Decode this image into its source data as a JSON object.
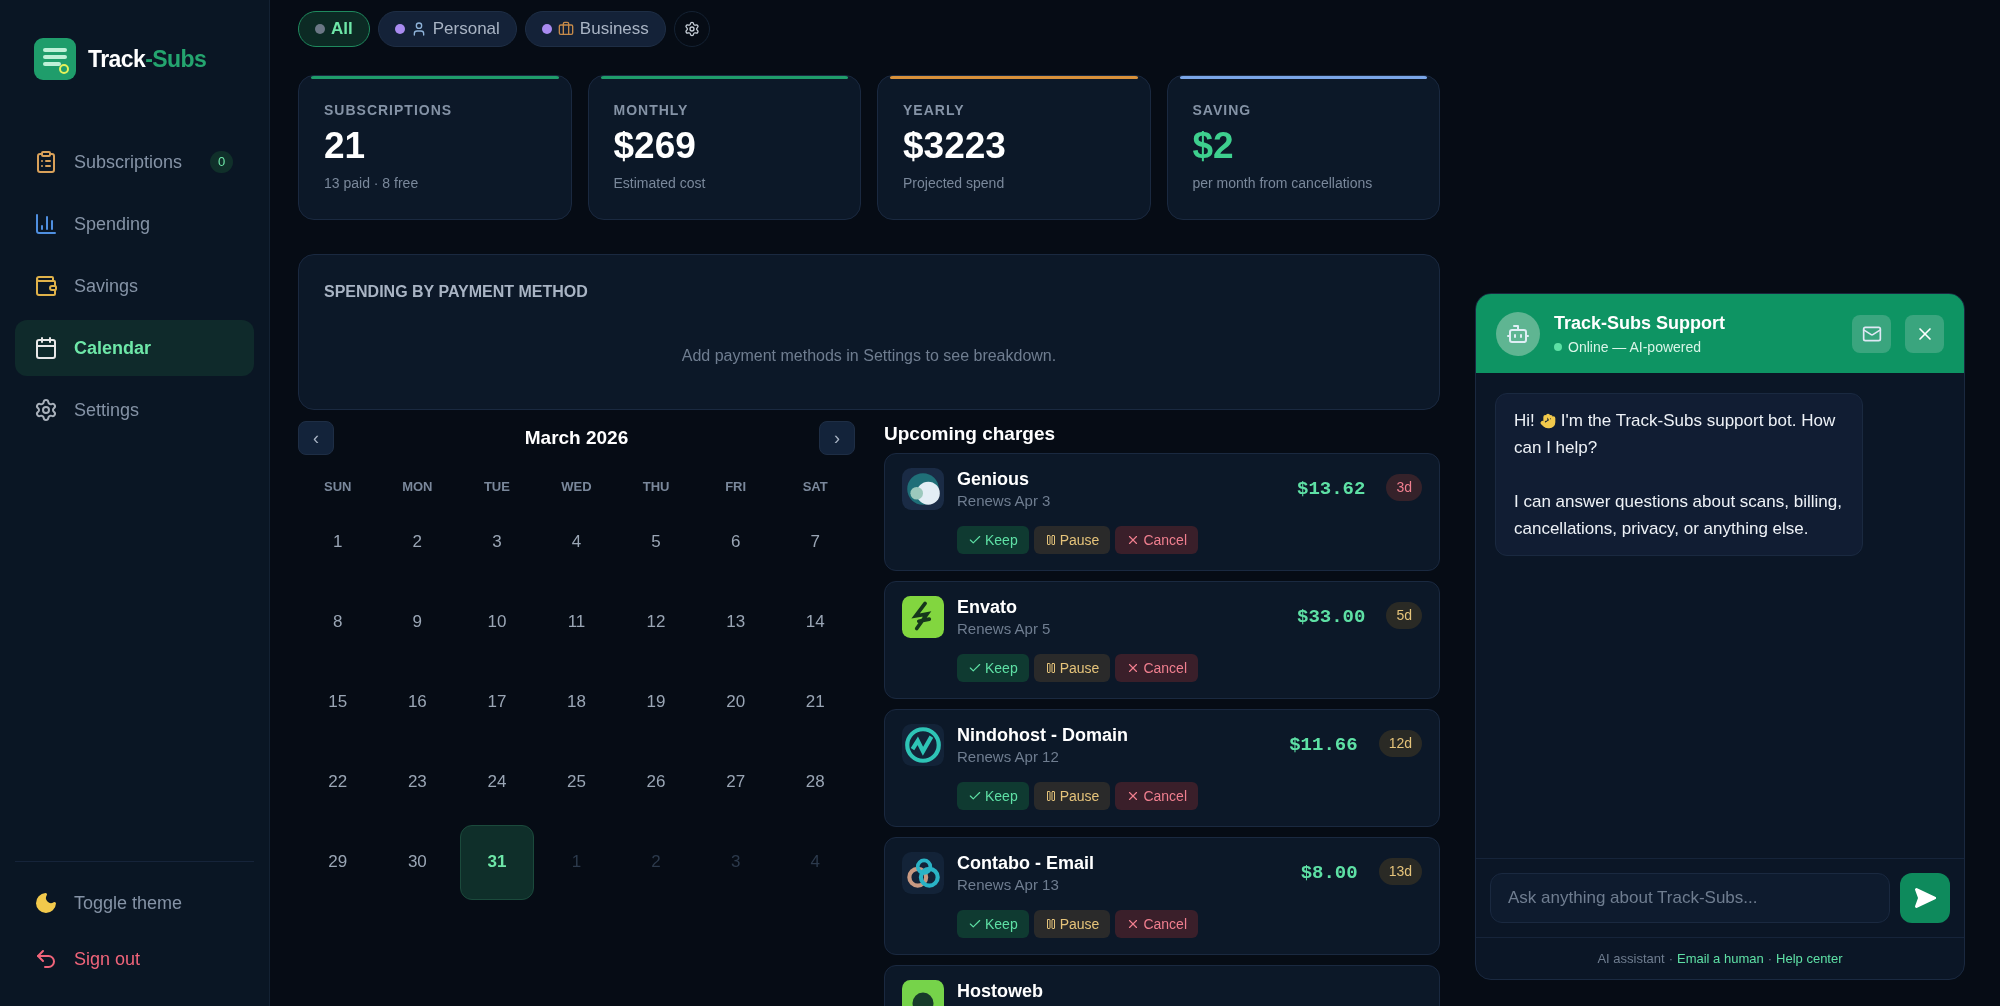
{
  "sidebar": {
    "brand": {
      "part_1": "Track",
      "part_2": "-Subs"
    },
    "nav": [
      {
        "label": "Subscriptions",
        "selected": false,
        "badge": "0"
      },
      {
        "label": "Spending",
        "selected": false
      },
      {
        "label": "Savings",
        "selected": false
      },
      {
        "label": "Calendar",
        "selected": true
      },
      {
        "label": "Settings",
        "selected": false
      }
    ],
    "footer": [
      {
        "label": "Toggle theme",
        "kind": "theme"
      },
      {
        "label": "Sign out",
        "kind": "signout"
      }
    ]
  },
  "filters": [
    {
      "label": "All",
      "color": "#6b7785",
      "selected": true
    },
    {
      "label": "Personal",
      "color": "#a98bf0",
      "selected": false
    },
    {
      "label": "Business",
      "color": "#a98bf0",
      "selected": false
    }
  ],
  "stats": [
    {
      "label": "SUBSCRIPTIONS",
      "value": "21",
      "note": "13 paid · 8 free",
      "color": "#1f9d6b",
      "highlight": false
    },
    {
      "label": "MONTHLY",
      "value": "$269",
      "note": "Estimated cost",
      "color": "#1f9d6b",
      "highlight": false
    },
    {
      "label": "YEARLY",
      "value": "$3223",
      "note": "Projected spend",
      "color": "#d8913a",
      "highlight": false
    },
    {
      "label": "SAVING",
      "value": "$2",
      "note": "per month from cancellations",
      "color": "#7aa6e8",
      "highlight": true
    }
  ],
  "payment_methods": {
    "title": "SPENDING BY PAYMENT METHOD",
    "empty_message": "Add payment methods in Settings to see breakdown."
  },
  "calendar": {
    "title": "March 2026",
    "prev": "‹",
    "next": "›",
    "weekdays": [
      "SUN",
      "MON",
      "TUE",
      "WED",
      "THU",
      "FRI",
      "SAT"
    ],
    "days": [
      {
        "label": "1",
        "kind": "current",
        "selected": false
      },
      {
        "label": "2",
        "kind": "current",
        "selected": false
      },
      {
        "label": "3",
        "kind": "current",
        "selected": false
      },
      {
        "label": "4",
        "kind": "current",
        "selected": false
      },
      {
        "label": "5",
        "kind": "current",
        "selected": false
      },
      {
        "label": "6",
        "kind": "current",
        "selected": false
      },
      {
        "label": "7",
        "kind": "current",
        "selected": false
      },
      {
        "label": "8",
        "kind": "current",
        "selected": false
      },
      {
        "label": "9",
        "kind": "current",
        "selected": false
      },
      {
        "label": "10",
        "kind": "current",
        "selected": false
      },
      {
        "label": "11",
        "kind": "current",
        "selected": false
      },
      {
        "label": "12",
        "kind": "current",
        "selected": false
      },
      {
        "label": "13",
        "kind": "current",
        "selected": false
      },
      {
        "label": "14",
        "kind": "current",
        "selected": false
      },
      {
        "label": "15",
        "kind": "current",
        "selected": false
      },
      {
        "label": "16",
        "kind": "current",
        "selected": false
      },
      {
        "label": "17",
        "kind": "current",
        "selected": false
      },
      {
        "label": "18",
        "kind": "current",
        "selected": false
      },
      {
        "label": "19",
        "kind": "current",
        "selected": false
      },
      {
        "label": "20",
        "kind": "current",
        "selected": false
      },
      {
        "label": "21",
        "kind": "current",
        "selected": false
      },
      {
        "label": "22",
        "kind": "current",
        "selected": false
      },
      {
        "label": "23",
        "kind": "current",
        "selected": false
      },
      {
        "label": "24",
        "kind": "current",
        "selected": false
      },
      {
        "label": "25",
        "kind": "current",
        "selected": false
      },
      {
        "label": "26",
        "kind": "current",
        "selected": false
      },
      {
        "label": "27",
        "kind": "current",
        "selected": false
      },
      {
        "label": "28",
        "kind": "current",
        "selected": false
      },
      {
        "label": "29",
        "kind": "current",
        "selected": false
      },
      {
        "label": "30",
        "kind": "current",
        "selected": false
      },
      {
        "label": "31",
        "kind": "current",
        "selected": true
      },
      {
        "label": "1",
        "kind": "other",
        "selected": false
      },
      {
        "label": "2",
        "kind": "other",
        "selected": false
      },
      {
        "label": "3",
        "kind": "other",
        "selected": false
      },
      {
        "label": "4",
        "kind": "other",
        "selected": false
      }
    ]
  },
  "upcoming": {
    "title": "Upcoming charges",
    "items": [
      {
        "name": "Genious",
        "renews": "Renews Apr 3",
        "price": "$13.62",
        "due": "3d",
        "urgent": true,
        "actions": [
          {
            "label": "Keep",
            "kind": "keep"
          },
          {
            "label": "Pause",
            "kind": "pause"
          },
          {
            "label": "Cancel",
            "kind": "cancel"
          }
        ]
      },
      {
        "name": "Envato",
        "renews": "Renews Apr 5",
        "price": "$33.00",
        "due": "5d",
        "urgent": false,
        "actions": [
          {
            "label": "Keep",
            "kind": "keep"
          },
          {
            "label": "Pause",
            "kind": "pause"
          },
          {
            "label": "Cancel",
            "kind": "cancel"
          }
        ]
      },
      {
        "name": "Nindohost - Domain",
        "renews": "Renews Apr 12",
        "price": "$11.66",
        "due": "12d",
        "urgent": false,
        "actions": [
          {
            "label": "Keep",
            "kind": "keep"
          },
          {
            "label": "Pause",
            "kind": "pause"
          },
          {
            "label": "Cancel",
            "kind": "cancel"
          }
        ]
      },
      {
        "name": "Contabo - Email",
        "renews": "Renews Apr 13",
        "price": "$8.00",
        "due": "13d",
        "urgent": false,
        "actions": [
          {
            "label": "Keep",
            "kind": "keep"
          },
          {
            "label": "Pause",
            "kind": "pause"
          },
          {
            "label": "Cancel",
            "kind": "cancel"
          }
        ]
      },
      {
        "name": "Hostoweb"
      }
    ]
  },
  "chat": {
    "title": "Track-Subs Support",
    "status": "Online — AI-powered",
    "online": true,
    "messages": [
      {
        "greeting": "Hi!",
        "first_line": "I'm the Track-Subs support bot. How",
        "continuation": "can I help?",
        "paragraph": "I can answer questions about scans, billing, cancellations, privacy, or anything else."
      }
    ],
    "input": {
      "placeholder": "Ask anything about Track-Subs..."
    },
    "footer": {
      "note": "AI assistant",
      "separator": "·",
      "links": [
        "Email a human",
        "Help center"
      ]
    }
  }
}
